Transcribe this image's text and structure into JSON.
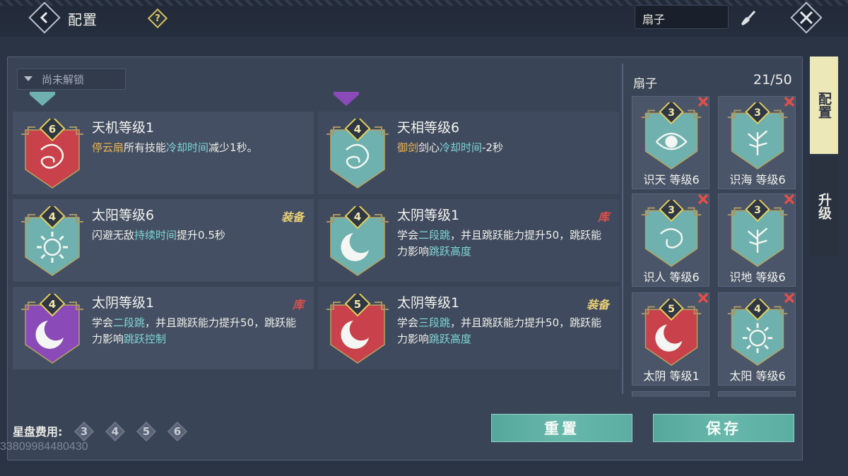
{
  "header": {
    "title": "配置",
    "help_symbol": "?",
    "search_value": "扇子"
  },
  "filter": {
    "dropdown_label": "尚未解锁"
  },
  "cards": [
    {
      "name": "天机等级1",
      "level": "6",
      "emblem_color": "#c9414b",
      "motif": "dragon",
      "desc": [
        {
          "t": "停云扇",
          "c": "orange"
        },
        {
          "t": "所有技能",
          "c": ""
        },
        {
          "t": "冷却时间",
          "c": "cyan"
        },
        {
          "t": "减少1秒。",
          "c": ""
        }
      ],
      "tag": ""
    },
    {
      "name": "天相等级6",
      "level": "4",
      "emblem_color": "#6fb1ae",
      "motif": "dragon",
      "desc": [
        {
          "t": "御剑",
          "c": "orange"
        },
        {
          "t": "剑心",
          "c": ""
        },
        {
          "t": "冷却时间",
          "c": "cyan"
        },
        {
          "t": "-2秒",
          "c": ""
        }
      ],
      "tag": ""
    },
    {
      "name": "太阳等级6",
      "level": "4",
      "emblem_color": "#6fb1ae",
      "motif": "sun",
      "desc": [
        {
          "t": "闪避无敌",
          "c": ""
        },
        {
          "t": "持续时间",
          "c": "cyan"
        },
        {
          "t": "提升0.5秒",
          "c": ""
        }
      ],
      "tag": "装备",
      "tag_color": "gold"
    },
    {
      "name": "太阴等级1",
      "level": "4",
      "emblem_color": "#6fb1ae",
      "motif": "moon",
      "desc": [
        {
          "t": "学会",
          "c": ""
        },
        {
          "t": "二段跳",
          "c": "cyan"
        },
        {
          "t": "，并且跳跃能力提升50，跳跃能力影响",
          "c": ""
        },
        {
          "t": "跳跃高度",
          "c": "cyan"
        }
      ],
      "tag": "库",
      "tag_color": "red"
    },
    {
      "name": "太阴等级1",
      "level": "4",
      "emblem_color": "#8a4bb8",
      "motif": "moon",
      "desc": [
        {
          "t": "学会",
          "c": ""
        },
        {
          "t": "二段跳",
          "c": "cyan"
        },
        {
          "t": "，并且跳跃能力提升50，跳跃能力影响",
          "c": ""
        },
        {
          "t": "跳跃控制",
          "c": "cyan"
        }
      ],
      "tag": "库",
      "tag_color": "red"
    },
    {
      "name": "太阴等级1",
      "level": "5",
      "emblem_color": "#c9414b",
      "motif": "moon",
      "desc": [
        {
          "t": "学会",
          "c": ""
        },
        {
          "t": "三段跳",
          "c": "cyan"
        },
        {
          "t": "，并且跳跃能力提升50，跳跃能力影响",
          "c": ""
        },
        {
          "t": "跳跃高度",
          "c": "cyan"
        }
      ],
      "tag": "装备",
      "tag_color": "gold"
    }
  ],
  "config": {
    "title": "扇子",
    "count": "21/50",
    "slots": [
      {
        "label": "识天 等级6",
        "level": "3",
        "emblem_color": "#6fb1ae",
        "motif": "eye"
      },
      {
        "label": "识海 等级6",
        "level": "3",
        "emblem_color": "#6fb1ae",
        "motif": "tree"
      },
      {
        "label": "识人 等级6",
        "level": "3",
        "emblem_color": "#6fb1ae",
        "motif": "swirl"
      },
      {
        "label": "识地 等级6",
        "level": "3",
        "emblem_color": "#6fb1ae",
        "motif": "tree"
      },
      {
        "label": "太阴 等级1",
        "level": "5",
        "emblem_color": "#c9414b",
        "motif": "moon"
      },
      {
        "label": "太阳 等级6",
        "level": "4",
        "emblem_color": "#6fb1ae",
        "motif": "sun"
      }
    ]
  },
  "tabs": {
    "config": "配置",
    "upgrade": "升级"
  },
  "bottom": {
    "cost_label": "星盘费用:",
    "costs": [
      "3",
      "4",
      "5",
      "6"
    ],
    "uid": "33809984480430",
    "reset_label": "重置",
    "save_label": "保存"
  },
  "colors": {
    "teal": "#6fb1ae",
    "red": "#c9414b",
    "purple": "#8a4bb8",
    "gold_badge": "#e3cf5e",
    "highlight_cyan": "#7fd7d5",
    "highlight_orange": "#f0b452"
  }
}
